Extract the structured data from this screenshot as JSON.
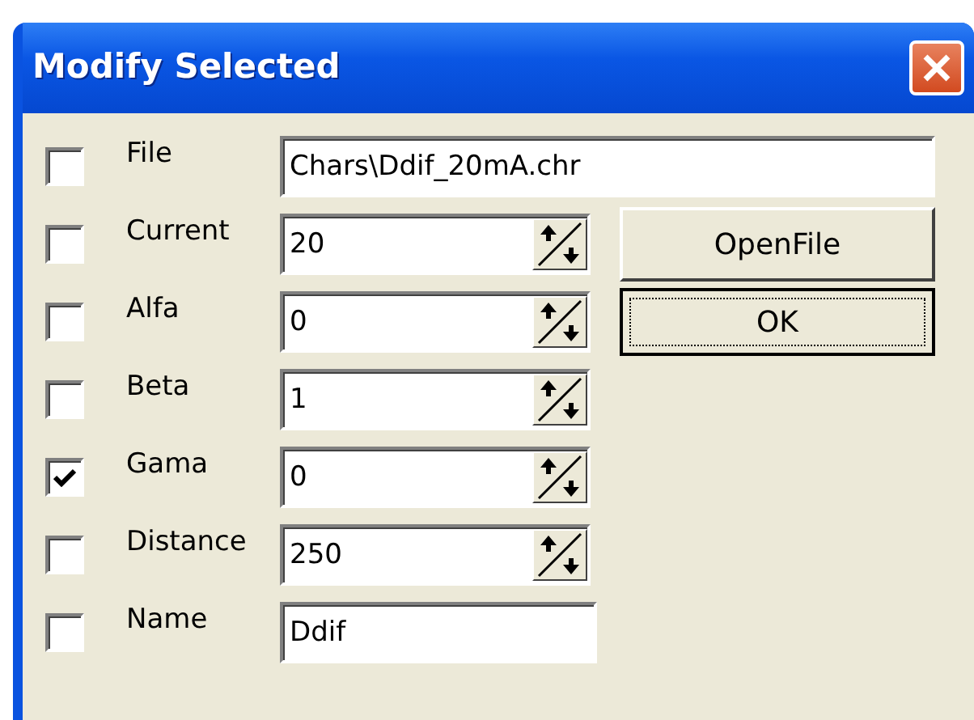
{
  "window": {
    "title": "Modify Selected"
  },
  "fields": [
    {
      "kind": "text",
      "label": "File",
      "value": "Chars\\Ddif_20mA.chr",
      "checked": false
    },
    {
      "kind": "spin",
      "label": "Current",
      "value": "20",
      "checked": false
    },
    {
      "kind": "spin",
      "label": "Alfa",
      "value": "0",
      "checked": false
    },
    {
      "kind": "spin",
      "label": "Beta",
      "value": "1",
      "checked": false
    },
    {
      "kind": "spin",
      "label": "Gama",
      "value": "0",
      "checked": true
    },
    {
      "kind": "spin",
      "label": "Distance",
      "value": "250",
      "checked": false
    },
    {
      "kind": "short",
      "label": "Name",
      "value": "Ddif",
      "checked": false
    }
  ],
  "buttons": [
    {
      "label": "OpenFile",
      "focused": false
    },
    {
      "label": "OK",
      "focused": true
    }
  ]
}
